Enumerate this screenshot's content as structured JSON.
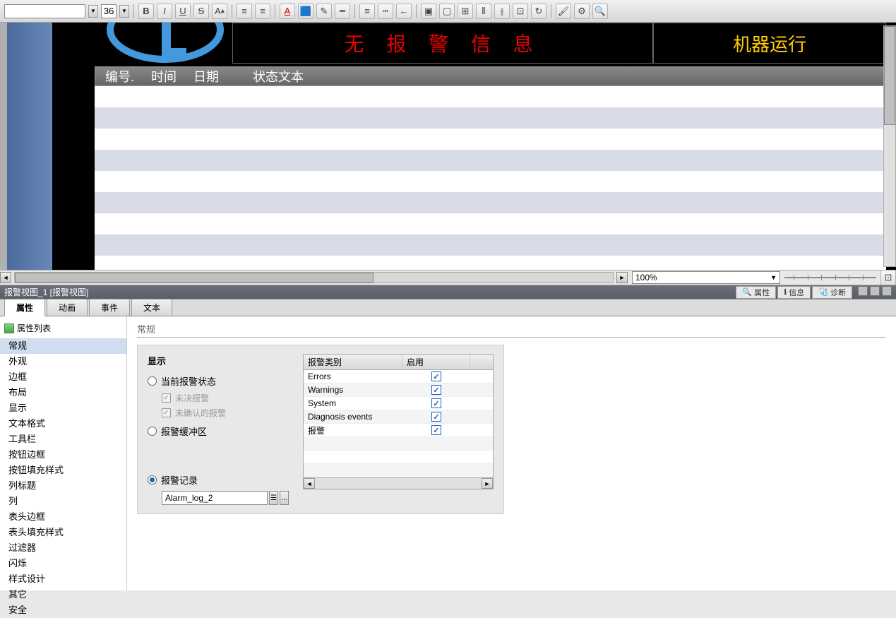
{
  "toolbar": {
    "font_size": "36",
    "bold": "B",
    "italic": "I",
    "underline": "U",
    "strike": "S"
  },
  "canvas": {
    "alarm_message": "无 报 警 信 息",
    "status_message": "机器运行",
    "table_headers": [
      "编号.",
      "时间",
      "日期",
      "状态文本"
    ]
  },
  "zoom": {
    "value": "100%"
  },
  "panel": {
    "title": "报警视图_1 [报警视图]",
    "buttons": {
      "properties": "属性",
      "info": "信息",
      "diagnostics": "诊断"
    }
  },
  "tabs": [
    "属性",
    "动画",
    "事件",
    "文本"
  ],
  "sidebar": {
    "header": "属性列表",
    "items": [
      "常规",
      "外观",
      "边框",
      "布局",
      "显示",
      "文本格式",
      "工具栏",
      "按钮边框",
      "按钮填充样式",
      "列标题",
      "列",
      "表头边框",
      "表头填充样式",
      "过滤器",
      "闪烁",
      "样式设计",
      "其它",
      "安全"
    ]
  },
  "content": {
    "section": "常规",
    "group_title": "显示",
    "radio1": "当前报警状态",
    "check1": "未决报警",
    "check2": "未确认的报警",
    "radio2": "报警缓冲区",
    "radio3": "报警记录",
    "log_name": "Alarm_log_2",
    "table": {
      "col1": "报警类别",
      "col2": "启用",
      "rows": [
        {
          "name": "Errors",
          "enabled": true
        },
        {
          "name": "Warnings",
          "enabled": true
        },
        {
          "name": "System",
          "enabled": true
        },
        {
          "name": "Diagnosis events",
          "enabled": true
        },
        {
          "name": "报警",
          "enabled": true
        }
      ]
    }
  }
}
